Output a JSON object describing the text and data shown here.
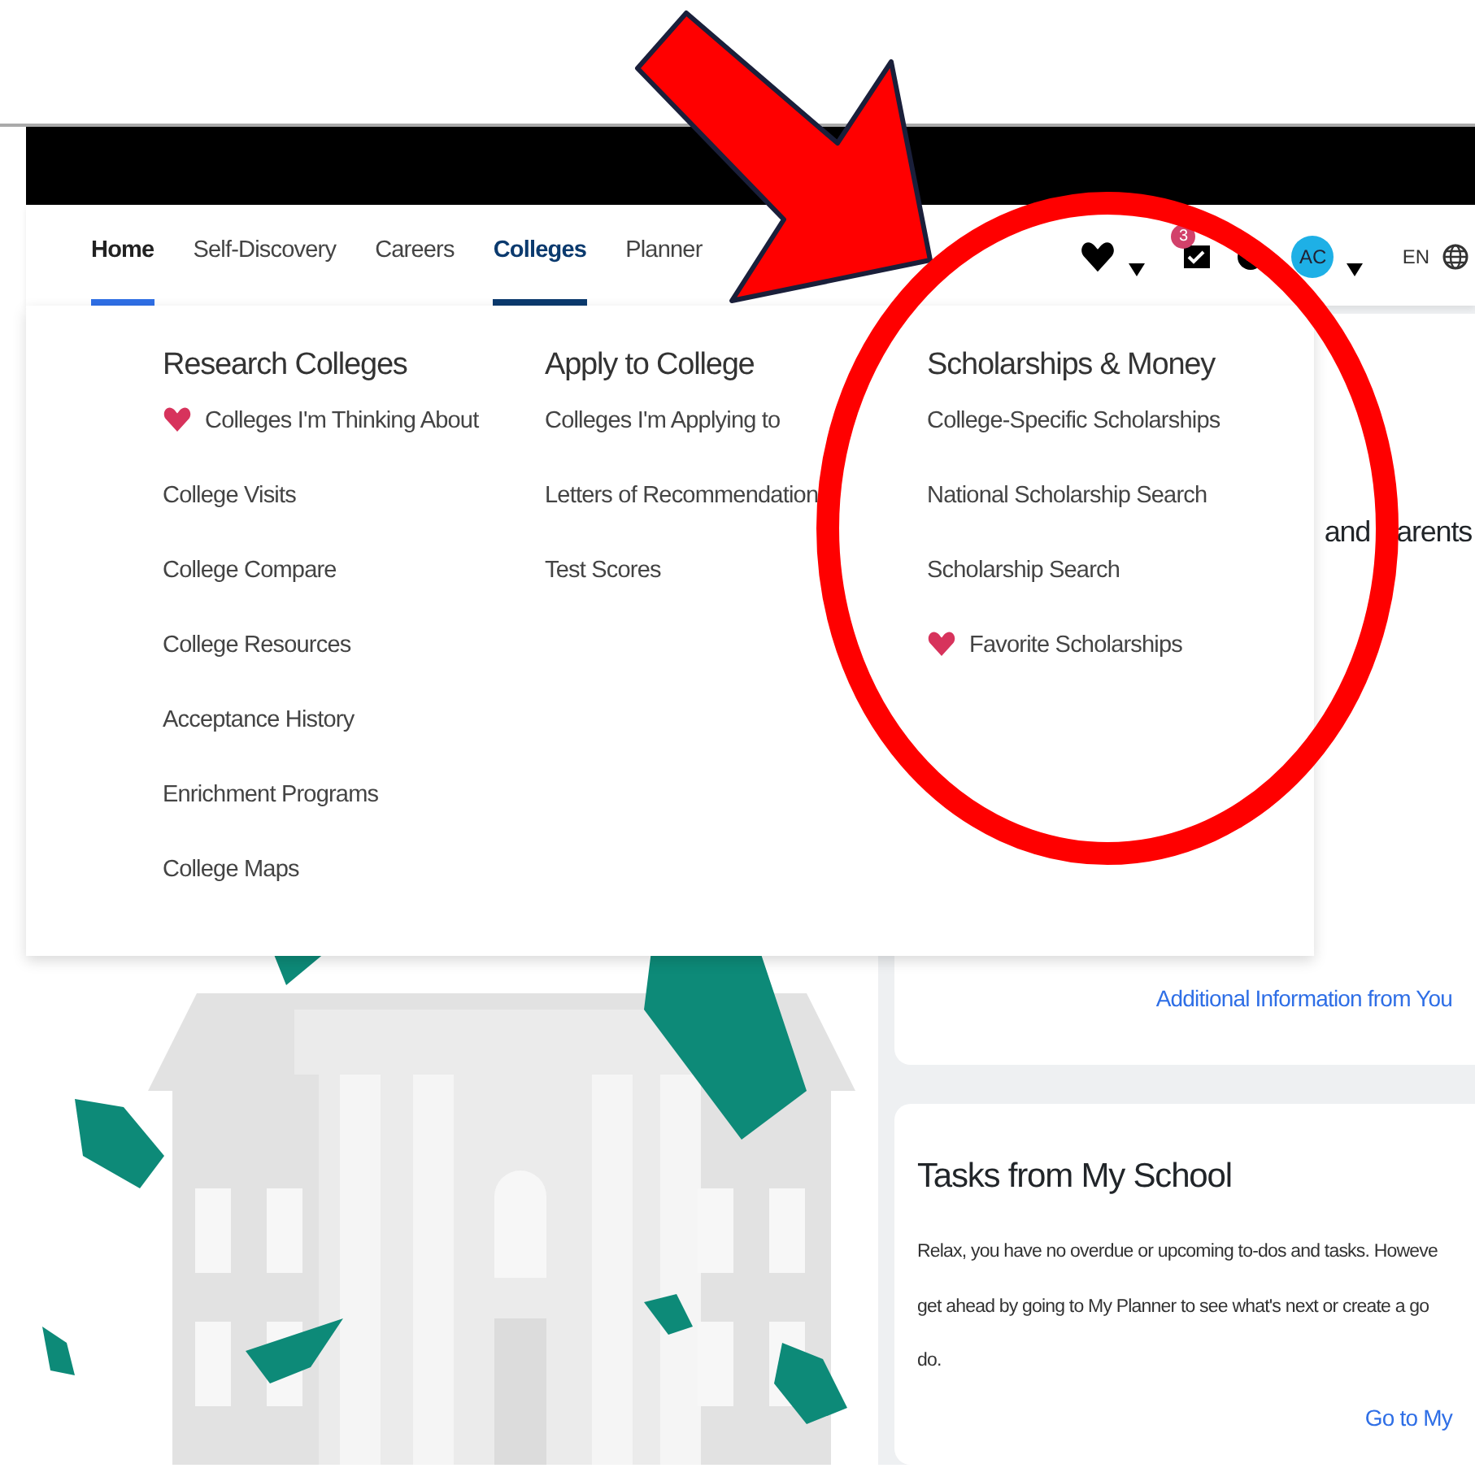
{
  "nav": {
    "tabs": [
      {
        "label": "Home",
        "selected": true,
        "expanded": false
      },
      {
        "label": "Self-Discovery",
        "selected": false,
        "expanded": false
      },
      {
        "label": "Careers",
        "selected": false,
        "expanded": false
      },
      {
        "label": "Colleges",
        "selected": false,
        "expanded": true
      },
      {
        "label": "Planner",
        "selected": false,
        "expanded": false
      }
    ],
    "notification_badge": "3",
    "avatar_initials": "AC",
    "language": "EN"
  },
  "menu": {
    "columns": [
      {
        "heading": "Research Colleges",
        "items": [
          {
            "label": "Colleges I'm Thinking About",
            "kind": "favorite"
          },
          {
            "label": "College Visits",
            "kind": "link"
          },
          {
            "label": "College Compare",
            "kind": "link"
          },
          {
            "label": "College Resources",
            "kind": "link"
          },
          {
            "label": "Acceptance History",
            "kind": "link"
          },
          {
            "label": "Enrichment Programs",
            "kind": "link"
          },
          {
            "label": "College Maps",
            "kind": "link"
          }
        ]
      },
      {
        "heading": "Apply to College",
        "items": [
          {
            "label": "Colleges I'm Applying to",
            "kind": "link"
          },
          {
            "label": "Letters of Recommendation",
            "kind": "link"
          },
          {
            "label": "Test Scores",
            "kind": "link"
          }
        ]
      },
      {
        "heading": "Scholarships & Money",
        "items": [
          {
            "label": "College-Specific Scholarships",
            "kind": "link"
          },
          {
            "label": "National Scholarship Search",
            "kind": "link"
          },
          {
            "label": "Scholarship Search",
            "kind": "link"
          },
          {
            "label": "Favorite Scholarships",
            "kind": "favorite"
          }
        ]
      }
    ]
  },
  "cards": [
    {
      "heading_parts": [
        "and",
        "arents"
      ],
      "link": "Additional Information from You"
    },
    {
      "heading": "Tasks from My School",
      "lines": [
        "Relax, you have no overdue or upcoming to-dos and tasks. Howeve",
        "get ahead by going to My Planner to see what's next or create a go",
        "do."
      ],
      "link": "Go to My"
    }
  ]
}
